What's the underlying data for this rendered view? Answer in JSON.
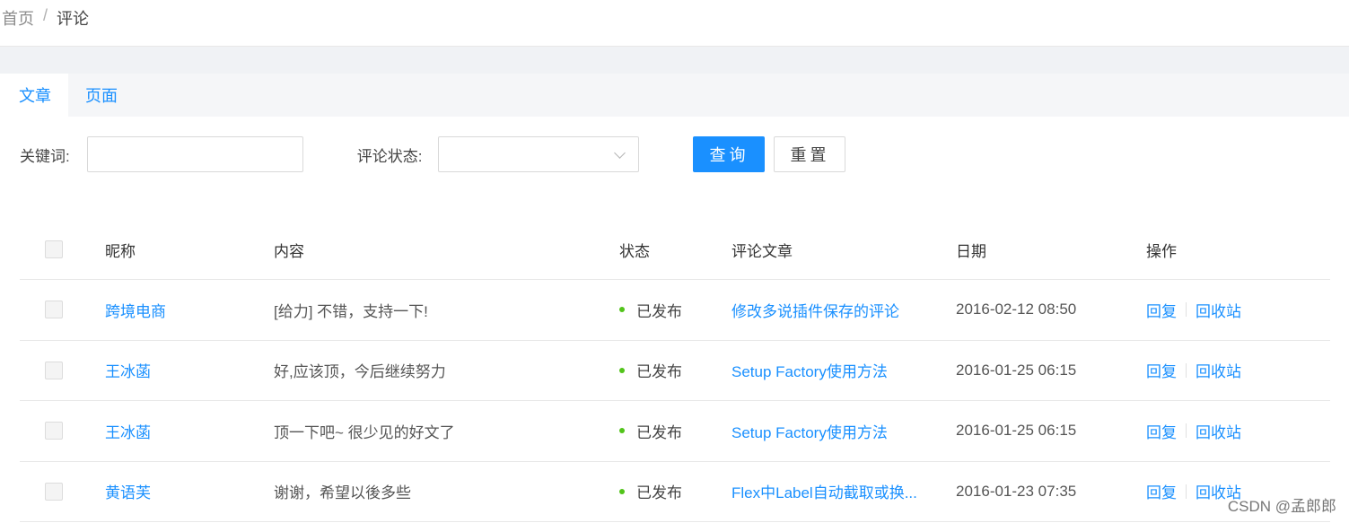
{
  "breadcrumb": {
    "home": "首页",
    "separator": "/",
    "current": "评论"
  },
  "tabs": [
    {
      "label": "文章",
      "active": true
    },
    {
      "label": "页面",
      "active": false
    }
  ],
  "filters": {
    "keyword_label": "关键词:",
    "keyword_value": "",
    "status_label": "评论状态:",
    "status_value": "",
    "query_button": "查询",
    "reset_button": "重置"
  },
  "table": {
    "headers": {
      "nickname": "昵称",
      "content": "内容",
      "status": "状态",
      "article": "评论文章",
      "date": "日期",
      "actions": "操作"
    },
    "rows": [
      {
        "nickname": "跨境电商",
        "content": "[给力] 不错，支持一下!",
        "status": "已发布",
        "article": "修改多说插件保存的评论",
        "date": "2016-02-12 08:50",
        "reply": "回复",
        "trash": "回收站"
      },
      {
        "nickname": "王冰菡",
        "content": "好,应该顶，今后继续努力",
        "status": "已发布",
        "article": "Setup Factory使用方法",
        "date": "2016-01-25 06:15",
        "reply": "回复",
        "trash": "回收站"
      },
      {
        "nickname": "王冰菡",
        "content": "顶一下吧~ 很少见的好文了",
        "status": "已发布",
        "article": "Setup Factory使用方法",
        "date": "2016-01-25 06:15",
        "reply": "回复",
        "trash": "回收站"
      },
      {
        "nickname": "黄语芙",
        "content": "谢谢，希望以後多些",
        "status": "已发布",
        "article": "Flex中Label自动截取或换...",
        "date": "2016-01-23 07:35",
        "reply": "回复",
        "trash": "回收站"
      }
    ]
  },
  "colors": {
    "primary": "#1a90ff",
    "published_dot": "#52c41a",
    "band": "#f0f2f5"
  },
  "watermark": "CSDN @孟郎郎"
}
